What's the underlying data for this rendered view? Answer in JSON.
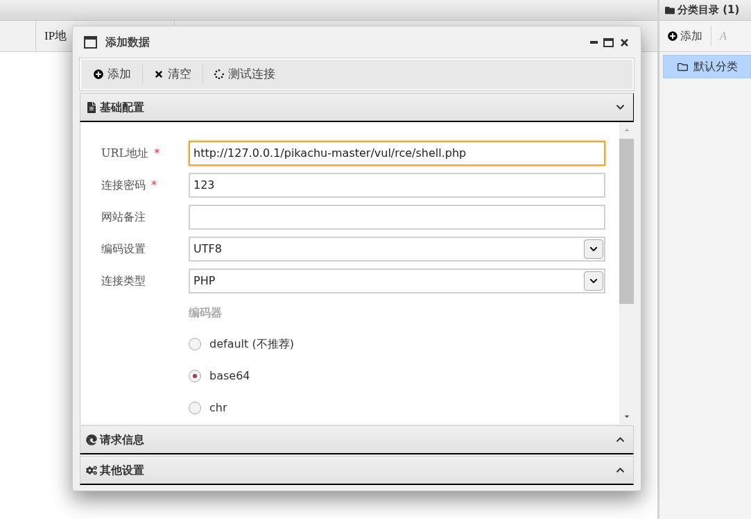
{
  "background_table": {
    "columns": [
      "",
      "IP地"
    ]
  },
  "category_panel": {
    "title": "分类目录 (1)",
    "toolbar": [
      "添加",
      "A"
    ],
    "items": [
      {
        "label": "默认分类",
        "selected": true
      }
    ]
  },
  "dialog": {
    "title": "添加数据",
    "toolbar": [
      {
        "kind": "add",
        "label": "添加"
      },
      {
        "kind": "clear",
        "label": "清空"
      },
      {
        "kind": "test",
        "label": "测试连接"
      }
    ],
    "sections": [
      {
        "kind": "basic",
        "title": "基础配置",
        "expanded": true
      },
      {
        "kind": "request",
        "title": "请求信息",
        "expanded": false
      },
      {
        "kind": "other",
        "title": "其他设置",
        "expanded": false
      }
    ],
    "fields": [
      {
        "kind": "text",
        "label": "URL地址",
        "required_mark": "*",
        "value": "http://127.0.0.1/pikachu-master/vul/rce/shell.php",
        "focused": true
      },
      {
        "kind": "text",
        "label": "连接密码",
        "required_mark": "*",
        "value": "123",
        "focused": false
      },
      {
        "kind": "text",
        "label": "网站备注",
        "focused": false
      },
      {
        "kind": "select",
        "label": "编码设置",
        "value": "UTF8"
      },
      {
        "kind": "select",
        "label": "连接类型",
        "value": "PHP"
      }
    ],
    "encoder": {
      "title": "编码器",
      "options": [
        {
          "label": "default (不推荐)",
          "selected": false
        },
        {
          "label": "base64",
          "selected": true
        },
        {
          "label": "chr",
          "selected": false
        }
      ]
    }
  }
}
